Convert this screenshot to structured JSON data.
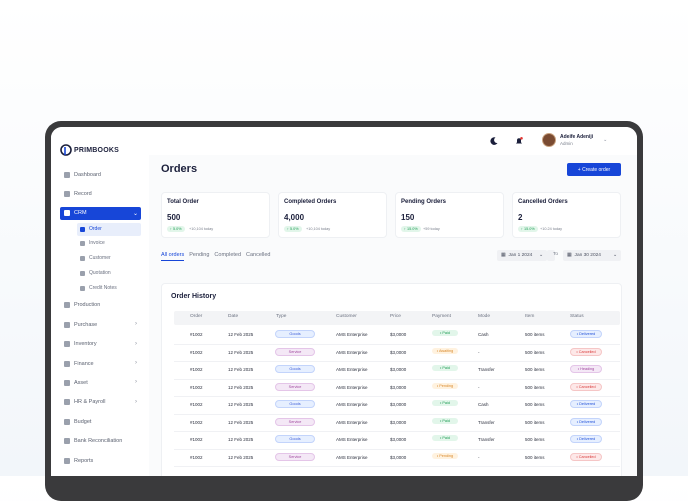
{
  "brand": {
    "name": "PRIMBOOKS"
  },
  "sidebar": {
    "items": [
      {
        "label": "Dashboard",
        "icon": "grid-icon"
      },
      {
        "label": "Record",
        "icon": "users-icon"
      },
      {
        "label": "CRM",
        "icon": "crm-icon",
        "active": true
      },
      {
        "label": "Production",
        "icon": "factory-icon"
      },
      {
        "label": "Purchase",
        "icon": "tag-icon",
        "chevron": true
      },
      {
        "label": "Inventory",
        "icon": "box-icon",
        "chevron": true
      },
      {
        "label": "Finance",
        "icon": "wallet-icon",
        "chevron": true
      },
      {
        "label": "Asset",
        "icon": "asset-icon",
        "chevron": true
      },
      {
        "label": "HR & Payroll",
        "icon": "briefcase-icon",
        "chevron": true
      },
      {
        "label": "Budget",
        "icon": "budget-icon"
      },
      {
        "label": "Bank Reconciliation",
        "icon": "bank-icon"
      },
      {
        "label": "Reports",
        "icon": "report-icon"
      }
    ],
    "crm_sub": [
      {
        "label": "Order",
        "active": true
      },
      {
        "label": "Invoice"
      },
      {
        "label": "Customer"
      },
      {
        "label": "Quotation"
      },
      {
        "label": "Credit Notes"
      }
    ]
  },
  "topbar": {
    "user_name": "Adeife Adeniji",
    "user_role": "Admin"
  },
  "page": {
    "title": "Orders",
    "create_button": "+ Create order"
  },
  "cards": [
    {
      "title": "Total Order",
      "value": "500",
      "badge": "↑ 5.0%",
      "note": "+10,104 today"
    },
    {
      "title": "Completed Orders",
      "value": "4,000",
      "badge": "↑ 5.0%",
      "note": "+10,104 today"
    },
    {
      "title": "Pending Orders",
      "value": "150",
      "badge": "↑ 15.0%",
      "note": "+59 today"
    },
    {
      "title": "Cancelled Orders",
      "value": "2",
      "badge": "↑ 15.0%",
      "note": "+10.24 today"
    }
  ],
  "tabs": [
    "All orders",
    "Pending",
    "Completed",
    "Cancelled"
  ],
  "date_filter": {
    "from": "Jan 1 2024",
    "to_label": "To",
    "to": "Jan 30 2024"
  },
  "history": {
    "title": "Order History",
    "columns": [
      "Order",
      "Date",
      "Type",
      "Customer",
      "Price",
      "Payment",
      "Mode",
      "Item",
      "Status"
    ],
    "rows": [
      {
        "order": "#1002",
        "date": "12 Feb 2025",
        "type": "Goods",
        "customer": "AMS Enterprise",
        "price": "$3,0000",
        "payment": "• Paid",
        "mode": "Cash",
        "item": "500 items",
        "status": "• Delivered"
      },
      {
        "order": "#1002",
        "date": "12 Feb 2025",
        "type": "Service",
        "customer": "AMS Enterprise",
        "price": "$3,0000",
        "payment": "• Awaiting",
        "mode": "-",
        "item": "500 items",
        "status": "• Cancelled"
      },
      {
        "order": "#1002",
        "date": "12 Feb 2025",
        "type": "Goods",
        "customer": "AMS Enterprise",
        "price": "$3,0000",
        "payment": "• Paid",
        "mode": "Transfer",
        "item": "500 items",
        "status": "• Heading"
      },
      {
        "order": "#1002",
        "date": "12 Feb 2025",
        "type": "Service",
        "customer": "AMS Enterprise",
        "price": "$3,0000",
        "payment": "• Pending",
        "mode": "-",
        "item": "500 items",
        "status": "• Cancelled"
      },
      {
        "order": "#1002",
        "date": "12 Feb 2025",
        "type": "Goods",
        "customer": "AMS Enterprise",
        "price": "$3,0000",
        "payment": "• Paid",
        "mode": "Cash",
        "item": "500 items",
        "status": "• Delivered"
      },
      {
        "order": "#1002",
        "date": "12 Feb 2025",
        "type": "Service",
        "customer": "AMS Enterprise",
        "price": "$3,0000",
        "payment": "• Paid",
        "mode": "Transfer",
        "item": "500 items",
        "status": "• Delivered"
      },
      {
        "order": "#1002",
        "date": "12 Feb 2025",
        "type": "Goods",
        "customer": "AMS Enterprise",
        "price": "$3,0000",
        "payment": "• Paid",
        "mode": "Transfer",
        "item": "500 items",
        "status": "• Delivered"
      },
      {
        "order": "#1002",
        "date": "12 Feb 2025",
        "type": "Service",
        "customer": "AMS Enterprise",
        "price": "$3,0000",
        "payment": "• Pending",
        "mode": "-",
        "item": "500 items",
        "status": "• Cancelled"
      }
    ]
  },
  "colors": {
    "accent": "#1746d8",
    "success": "#1f9d55",
    "warning": "#d9882a",
    "danger": "#d93a3a"
  }
}
